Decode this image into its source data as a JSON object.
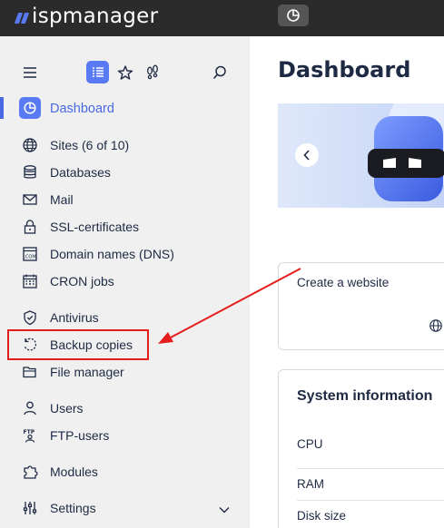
{
  "app": {
    "logo_text": "ispmanager"
  },
  "sidebar": {
    "items": [
      {
        "id": "dashboard",
        "label": "Dashboard",
        "icon": "pie-chart-icon",
        "active": true
      },
      {
        "id": "sites",
        "label": "Sites (6 of 10)",
        "icon": "globe-icon"
      },
      {
        "id": "databases",
        "label": "Databases",
        "icon": "database-icon"
      },
      {
        "id": "mail",
        "label": "Mail",
        "icon": "mail-icon"
      },
      {
        "id": "ssl",
        "label": "SSL-certificates",
        "icon": "lock-icon"
      },
      {
        "id": "dns",
        "label": "Domain names (DNS)",
        "icon": "com-domain-icon"
      },
      {
        "id": "cron",
        "label": "CRON jobs",
        "icon": "calendar-icon"
      },
      {
        "id": "antivirus",
        "label": "Antivirus",
        "icon": "shield-check-icon"
      },
      {
        "id": "backup",
        "label": "Backup copies",
        "icon": "backup-icon"
      },
      {
        "id": "files",
        "label": "File manager",
        "icon": "folder-icon"
      },
      {
        "id": "users",
        "label": "Users",
        "icon": "user-icon"
      },
      {
        "id": "ftp",
        "label": "FTP-users",
        "icon": "ftp-icon"
      },
      {
        "id": "modules",
        "label": "Modules",
        "icon": "puzzle-icon"
      },
      {
        "id": "settings",
        "label": "Settings",
        "icon": "sliders-icon"
      }
    ],
    "toolbar_icons": [
      "menu-icon",
      "list-icon",
      "star-icon",
      "footsteps-icon",
      "search-icon"
    ]
  },
  "main": {
    "title": "Dashboard",
    "cards": {
      "create_website": "Create a website",
      "system_information": "System information",
      "system_rows": [
        "CPU",
        "RAM",
        "Disk size"
      ]
    }
  },
  "colors": {
    "accent": "#4a68e3",
    "topbar": "#2b2b2b",
    "annotation": "#e51d1d"
  }
}
